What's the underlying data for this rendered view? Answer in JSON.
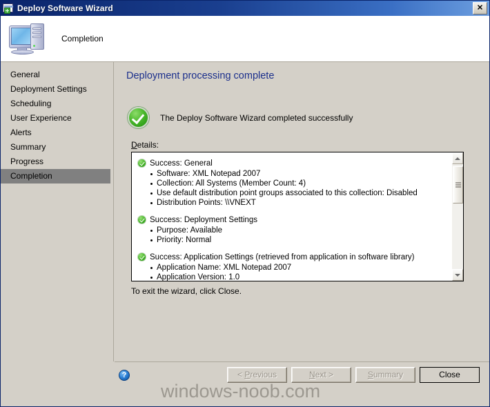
{
  "window": {
    "title": "Deploy Software Wizard",
    "icon": "wizard-window-icon",
    "close_label": "✕"
  },
  "header": {
    "title": "Completion",
    "icon": "computer-icon"
  },
  "sidebar": {
    "items": [
      {
        "label": "General",
        "selected": false
      },
      {
        "label": "Deployment Settings",
        "selected": false
      },
      {
        "label": "Scheduling",
        "selected": false
      },
      {
        "label": "User Experience",
        "selected": false
      },
      {
        "label": "Alerts",
        "selected": false
      },
      {
        "label": "Summary",
        "selected": false
      },
      {
        "label": "Progress",
        "selected": false
      },
      {
        "label": "Completion",
        "selected": true
      }
    ]
  },
  "main": {
    "heading": "Deployment processing complete",
    "success_message": "The Deploy Software Wizard completed successfully",
    "details_label_accel": "D",
    "details_label_rest": "etails:",
    "exit_note": "To exit the wizard, click Close.",
    "details": [
      {
        "status": "Success",
        "title": "Success: General",
        "bullets": [
          "Software: XML Notepad 2007",
          "Collection: All Systems (Member Count: 4)",
          "Use default distribution point groups associated to this collection: Disabled",
          "Distribution Points: \\\\VNEXT"
        ]
      },
      {
        "status": "Success",
        "title": "Success: Deployment Settings",
        "bullets": [
          "Purpose: Available",
          "Priority: Normal"
        ]
      },
      {
        "status": "Success",
        "title": "Success: Application Settings (retrieved from application in software library)",
        "bullets": [
          "Application Name: XML Notepad 2007",
          "Application Version: 1.0"
        ]
      }
    ]
  },
  "footer": {
    "help_glyph": "?",
    "buttons": [
      {
        "id": "previous",
        "accel": "P",
        "before": "< ",
        "after": "revious",
        "disabled": true,
        "default": false
      },
      {
        "id": "next",
        "accel": "N",
        "before": "",
        "after": "ext >",
        "disabled": true,
        "default": false
      },
      {
        "id": "summary",
        "accel": "S",
        "before": "",
        "after": "ummary",
        "disabled": true,
        "default": false
      },
      {
        "id": "close",
        "accel": "",
        "before": "Close",
        "after": "",
        "disabled": false,
        "default": true
      }
    ]
  },
  "watermark": "windows-noob.com",
  "colors": {
    "title_bar": "#0a246a",
    "face": "#d4d0c8",
    "heading": "#1b2f8c",
    "selection": "#808080",
    "success_green": "#4ab82c"
  }
}
